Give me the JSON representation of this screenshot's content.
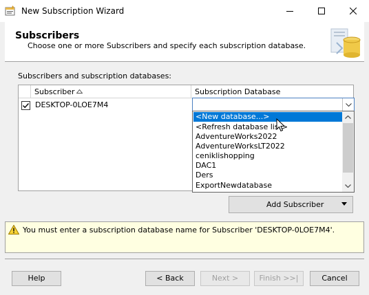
{
  "window": {
    "title": "New Subscription Wizard"
  },
  "header": {
    "title": "Subscribers",
    "subtitle": "Choose one or more Subscribers and specify each subscription database."
  },
  "grid": {
    "label": "Subscribers and subscription databases:",
    "columns": [
      "Subscriber",
      "Subscription Database"
    ],
    "rows": [
      {
        "checked": true,
        "subscriber": "DESKTOP-0LOE7M4",
        "database": ""
      }
    ]
  },
  "dropdown": {
    "selected_index": 0,
    "items": [
      "<New database...>",
      "<Refresh database list>",
      "AdventureWorks2022",
      "AdventureWorksLT2022",
      "ceniklishopping",
      "DAC1",
      "Ders",
      "ExportNewdatabase"
    ]
  },
  "add_subscriber_label": "Add Subscriber",
  "message": "You must enter a subscription database name for Subscriber 'DESKTOP-0LOE7M4'.",
  "buttons": {
    "help": "Help",
    "back": "< Back",
    "next": "Next >",
    "finish": "Finish >>|",
    "cancel": "Cancel"
  },
  "icons": {
    "app": "wizard-app-icon",
    "logo": "database-wizard-logo",
    "warning": "warning-icon"
  },
  "colors": {
    "selection": "#0078d7",
    "message_bg": "#ffffe1",
    "combo_border": "#4a7fc1"
  }
}
